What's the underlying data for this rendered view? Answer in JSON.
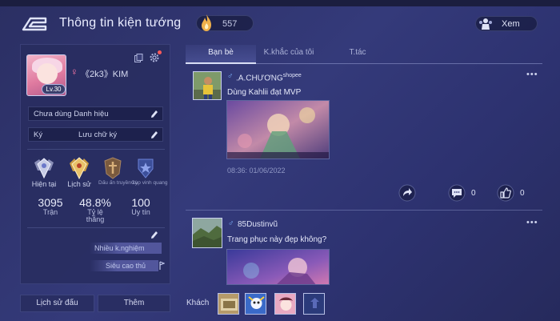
{
  "header": {
    "title": "Thông tin kiện tướng",
    "coins": "557",
    "view_label": "Xem"
  },
  "profile": {
    "name": "《2k3》KIM",
    "level": "Lv.30",
    "title_field": "Chưa dùng Danh hiệu",
    "signature_label": "Ký",
    "signature_value": "Lưu chữ ký",
    "ranks": [
      {
        "label": "Hiện tại",
        "icon": "rank-current-icon"
      },
      {
        "label": "Lịch sử",
        "icon": "rank-history-icon"
      },
      {
        "label": "Dấu ấn truyền kỳ",
        "icon": "legendary-mark-icon"
      },
      {
        "label": "Cup vinh quang",
        "icon": "glory-cup-icon"
      }
    ],
    "stats": [
      {
        "value": "3095",
        "label": "Trận"
      },
      {
        "value": "48.8%",
        "label": "Tỷ lệ thắng"
      },
      {
        "value": "100",
        "label": "Uy tín"
      }
    ],
    "tags": [
      "Nhiều k.nghiệm",
      "Siêu cao thủ"
    ]
  },
  "bottom_buttons": {
    "history": "Lịch sử đấu",
    "more": "Thêm"
  },
  "tabs": [
    {
      "label": "Bạn bè",
      "active": true
    },
    {
      "label": "K.khắc của tôi",
      "active": false
    },
    {
      "label": "T.tác",
      "active": false
    }
  ],
  "posts": [
    {
      "author": ".A.CHƯƠNG",
      "author_suffix": "shopee",
      "text": "Dùng Kahlii đạt MVP",
      "time": "08:36: 01/06/2022",
      "comments": "0",
      "likes": "0"
    },
    {
      "author": "85Dustinvũ",
      "author_suffix": "",
      "text": "Trang phục này đẹp không?"
    }
  ],
  "visitors": {
    "label": "Khách"
  },
  "colors": {
    "background": "#30357a",
    "panel": "#282d5f",
    "female": "#ff7aa8",
    "male": "#7fb6ff"
  }
}
